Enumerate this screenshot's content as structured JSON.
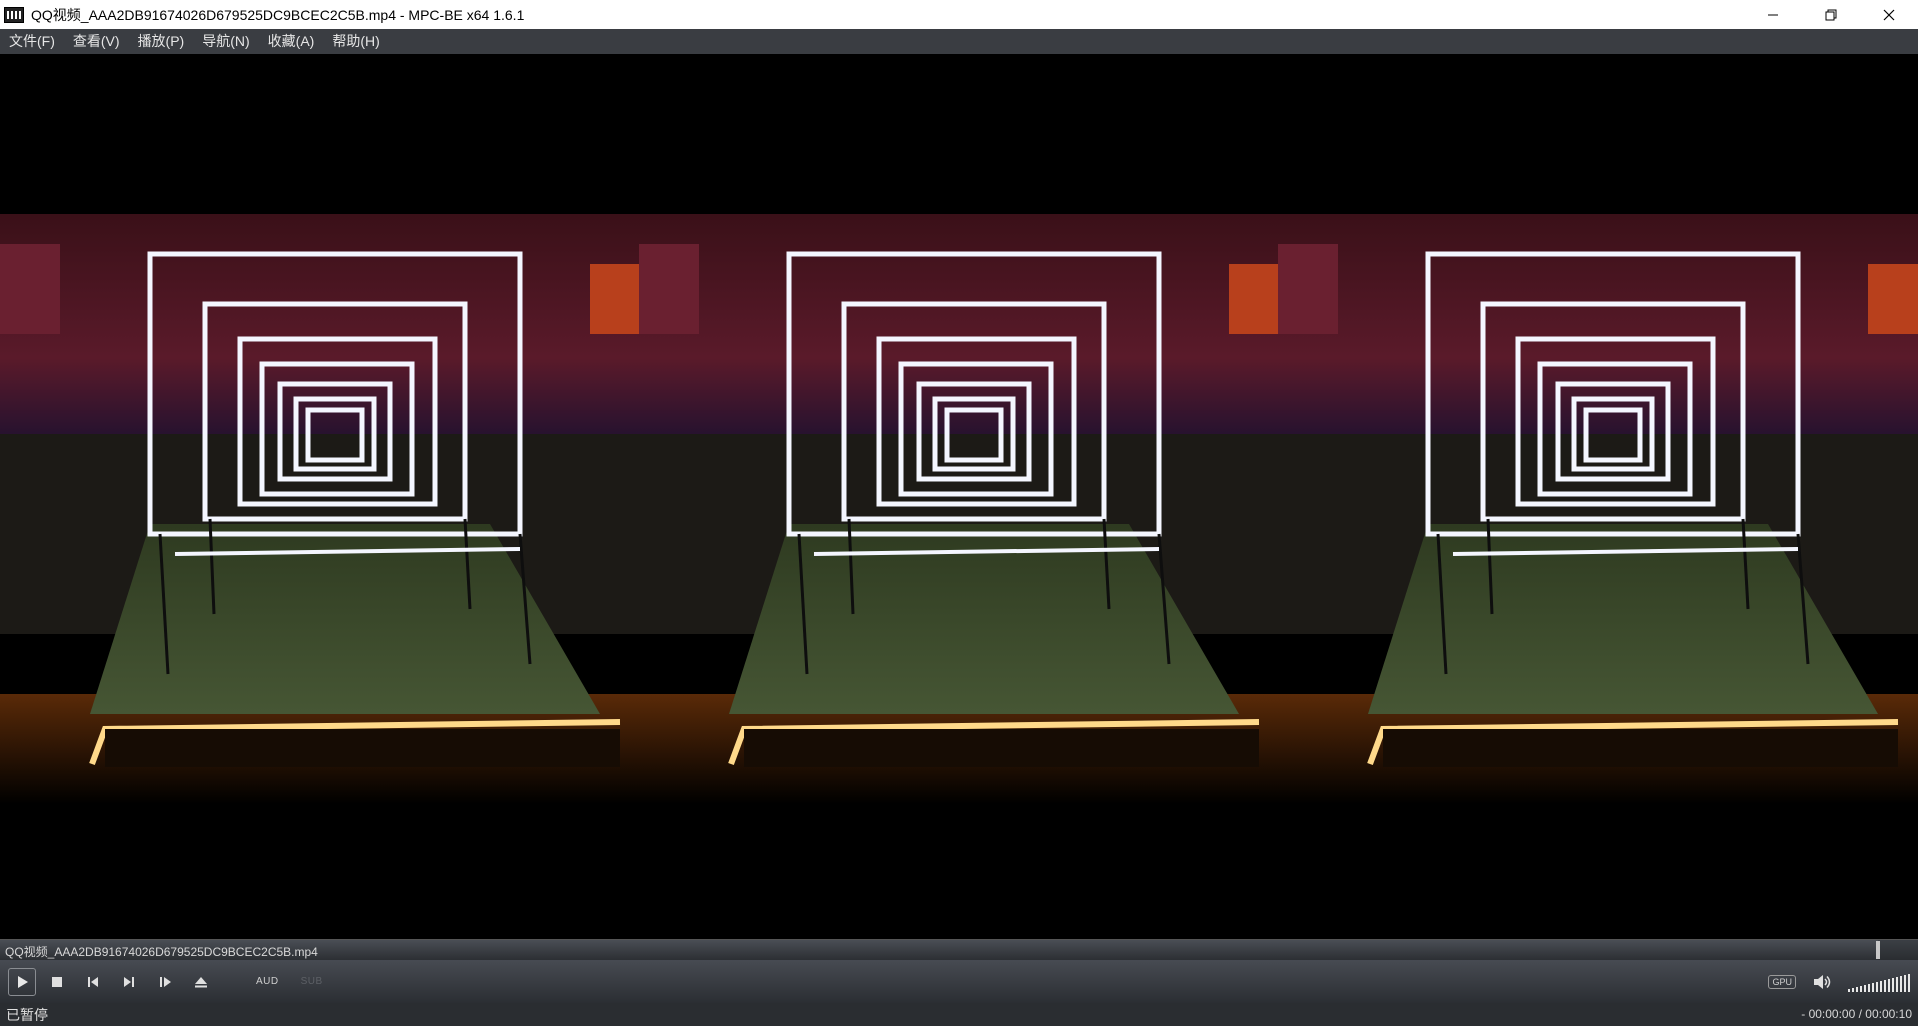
{
  "window": {
    "title": "QQ视频_AAA2DB91674026D679525DC9BCEC2C5B.mp4 - MPC-BE x64 1.6.1"
  },
  "menu": {
    "items": [
      {
        "label": "文件(F)"
      },
      {
        "label": "查看(V)"
      },
      {
        "label": "播放(P)"
      },
      {
        "label": "导航(N)"
      },
      {
        "label": "收藏(A)"
      },
      {
        "label": "帮助(H)"
      }
    ]
  },
  "seek": {
    "filename": "QQ视频_AAA2DB91674026D679525DC9BCEC2C5B.mp4"
  },
  "toolbar": {
    "aud_label": "AUD",
    "sub_label": "SUB",
    "gpu_label": "GPU",
    "volume_level": 1.0
  },
  "status": {
    "state": "已暂停",
    "time": "- 00:00:00 / 00:00:10"
  },
  "colors": {
    "menu_bg": "#3a3d42",
    "toolbar_bg": "#2b2e33",
    "led_white": "#f4f6ff",
    "led_warm": "#ffd98a",
    "floor_green": "#3b4a2b"
  }
}
